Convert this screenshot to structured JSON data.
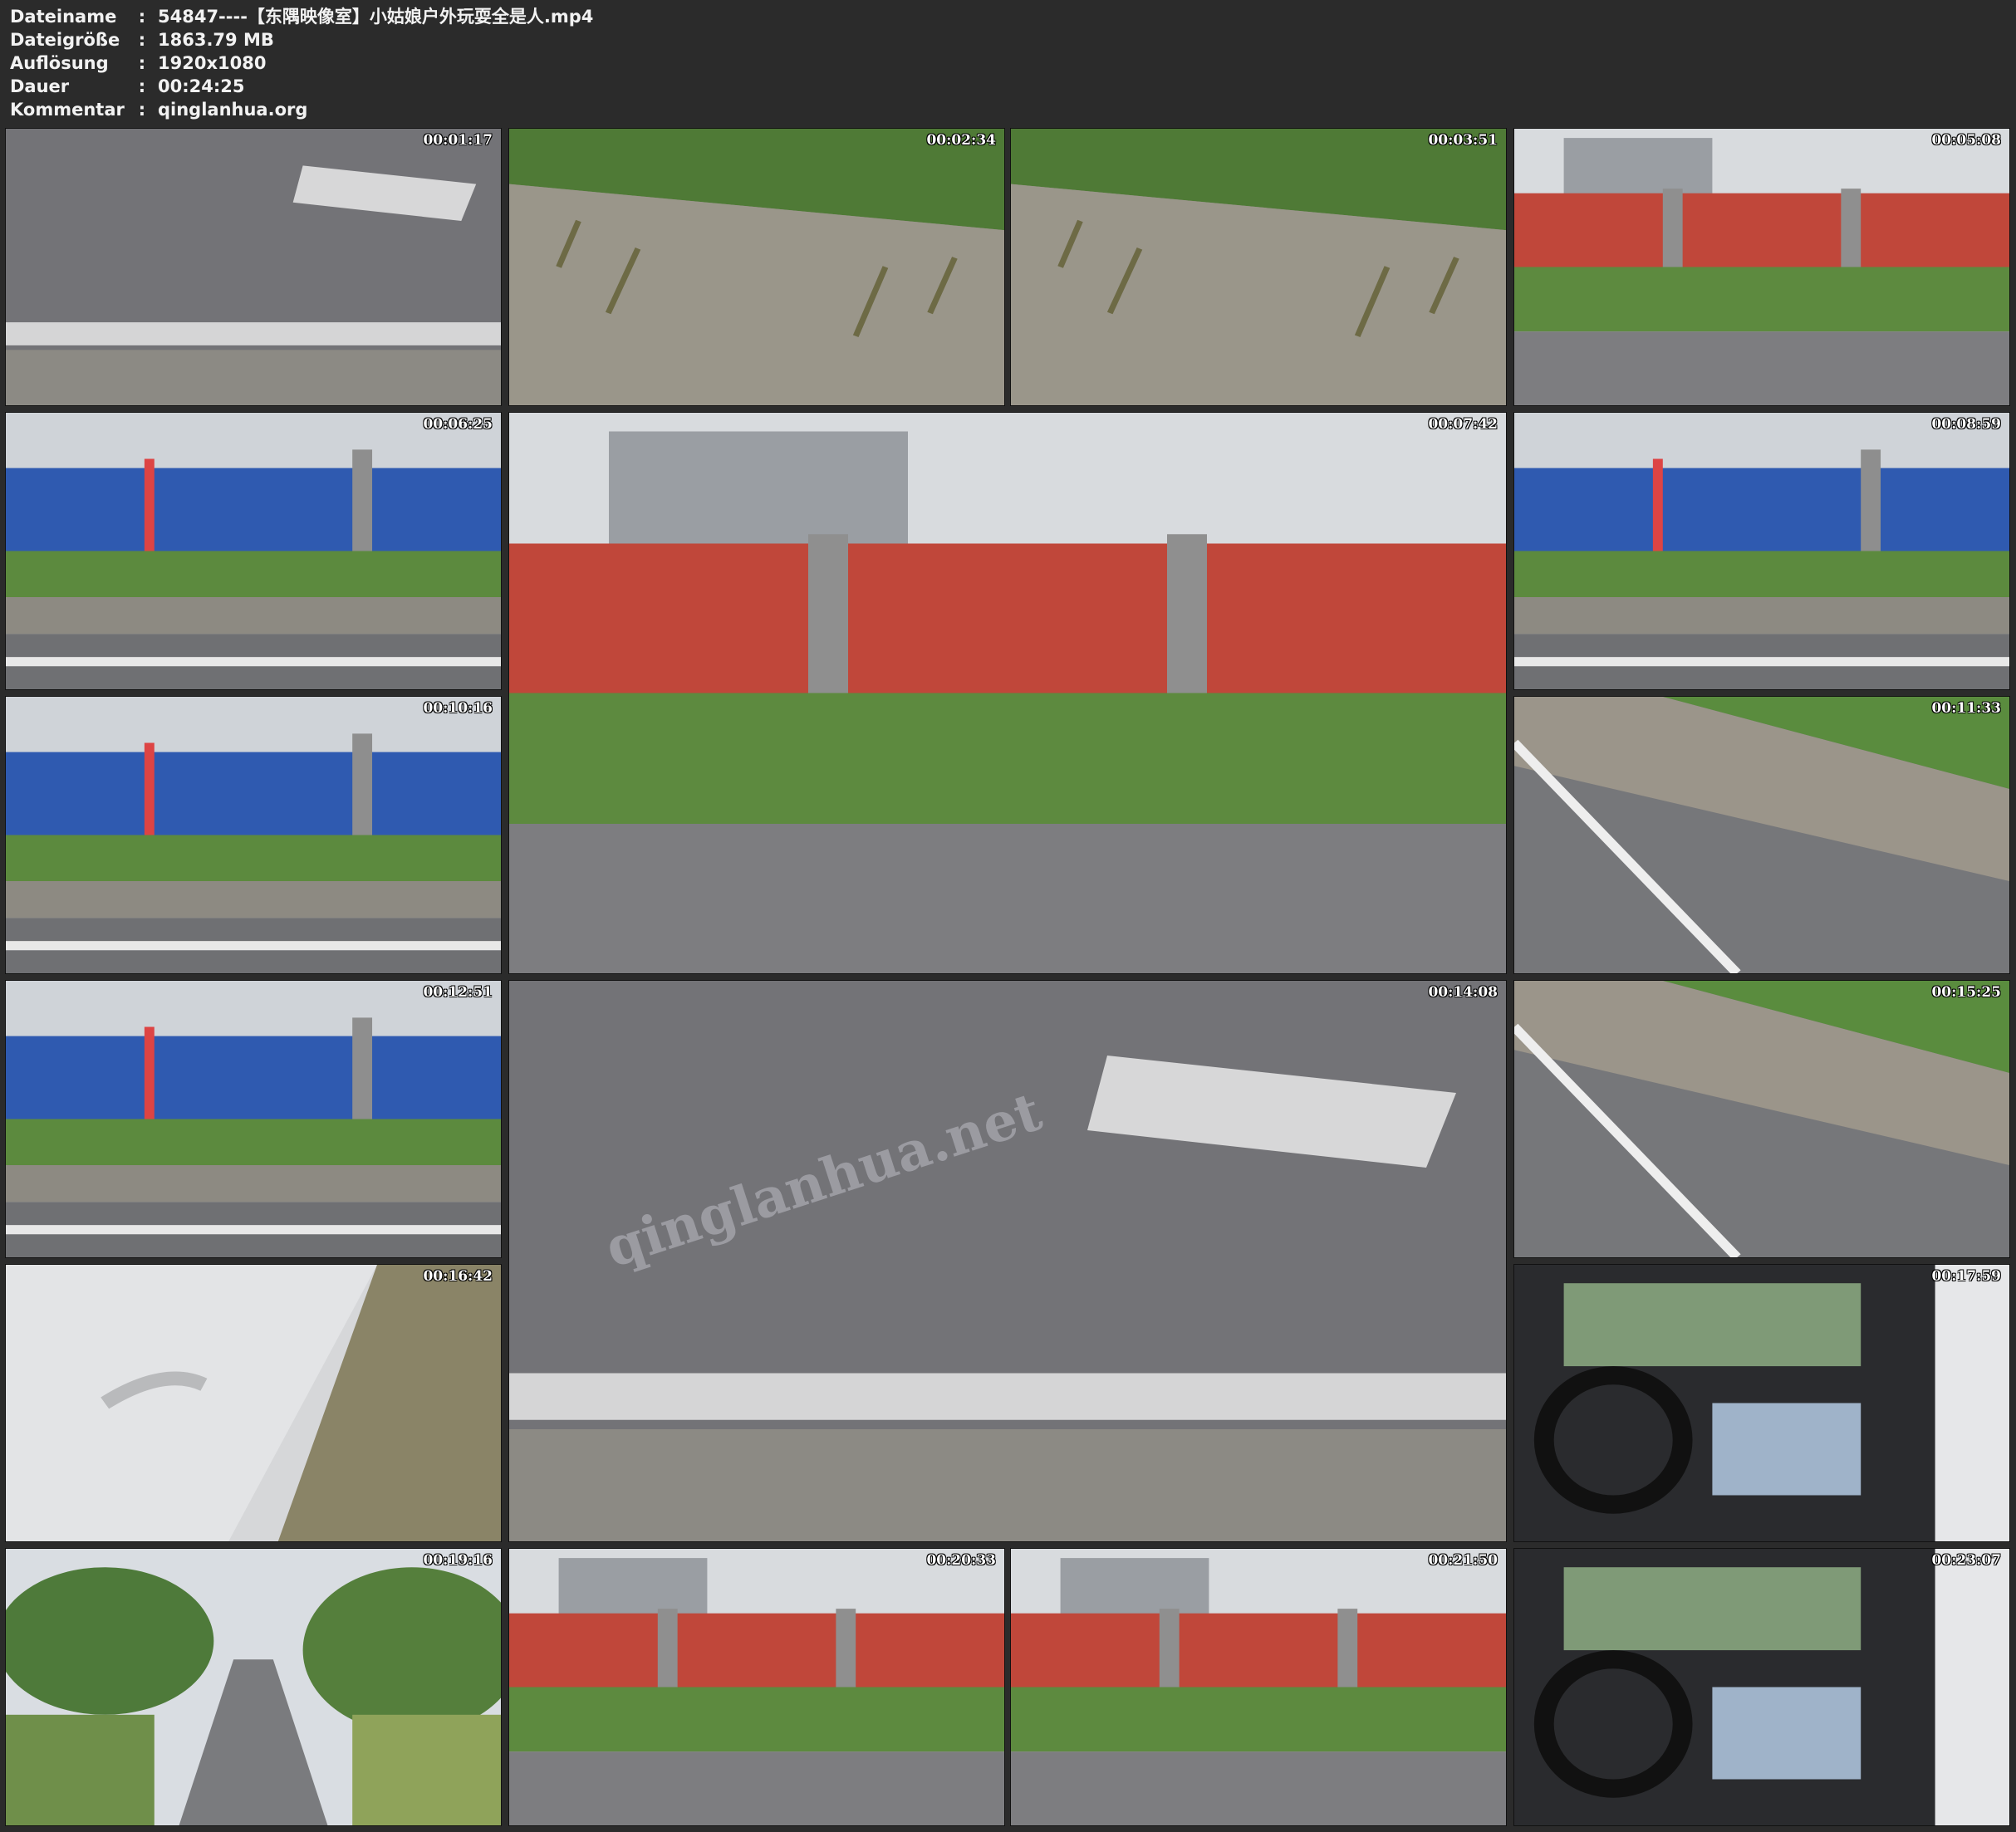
{
  "file_info": {
    "rows": [
      {
        "label": "Dateiname",
        "value": "54847----【东隅映像室】小姑娘户外玩耍全是人.mp4"
      },
      {
        "label": "Dateigröße",
        "value": "1863.79 MB"
      },
      {
        "label": "Auflösung",
        "value": "1920x1080"
      },
      {
        "label": "Dauer",
        "value": "00:24:25"
      },
      {
        "label": "Kommentar",
        "value": "qinglanhua.org"
      }
    ],
    "separator": ":"
  },
  "thumbnails": [
    {
      "timestamp": "00:01:17",
      "scene": "asphalt"
    },
    {
      "timestamp": "00:02:34",
      "scene": "grass"
    },
    {
      "timestamp": "00:03:51",
      "scene": "grass"
    },
    {
      "timestamp": "00:05:08",
      "scene": "redwall"
    },
    {
      "timestamp": "00:06:25",
      "scene": "bluefence"
    },
    {
      "timestamp": "00:07:42",
      "scene": "redwall"
    },
    {
      "timestamp": "00:08:59",
      "scene": "bluefence"
    },
    {
      "timestamp": "00:10:16",
      "scene": "bluefence"
    },
    {
      "timestamp": "00:11:33",
      "scene": "roadside"
    },
    {
      "timestamp": "00:12:51",
      "scene": "bluefence"
    },
    {
      "timestamp": "00:14:08",
      "scene": "asphalt"
    },
    {
      "timestamp": "00:15:25",
      "scene": "roadside"
    },
    {
      "timestamp": "00:16:42",
      "scene": "car"
    },
    {
      "timestamp": "00:17:59",
      "scene": "carinterior"
    },
    {
      "timestamp": "00:19:16",
      "scene": "trees"
    },
    {
      "timestamp": "00:20:33",
      "scene": "redwall"
    },
    {
      "timestamp": "00:21:50",
      "scene": "redwall"
    },
    {
      "timestamp": "00:23:07",
      "scene": "carinterior"
    }
  ],
  "watermark": "qinglanhua.net",
  "colors": {
    "background": "#2b2b2b",
    "text": "#f2f2f2"
  }
}
